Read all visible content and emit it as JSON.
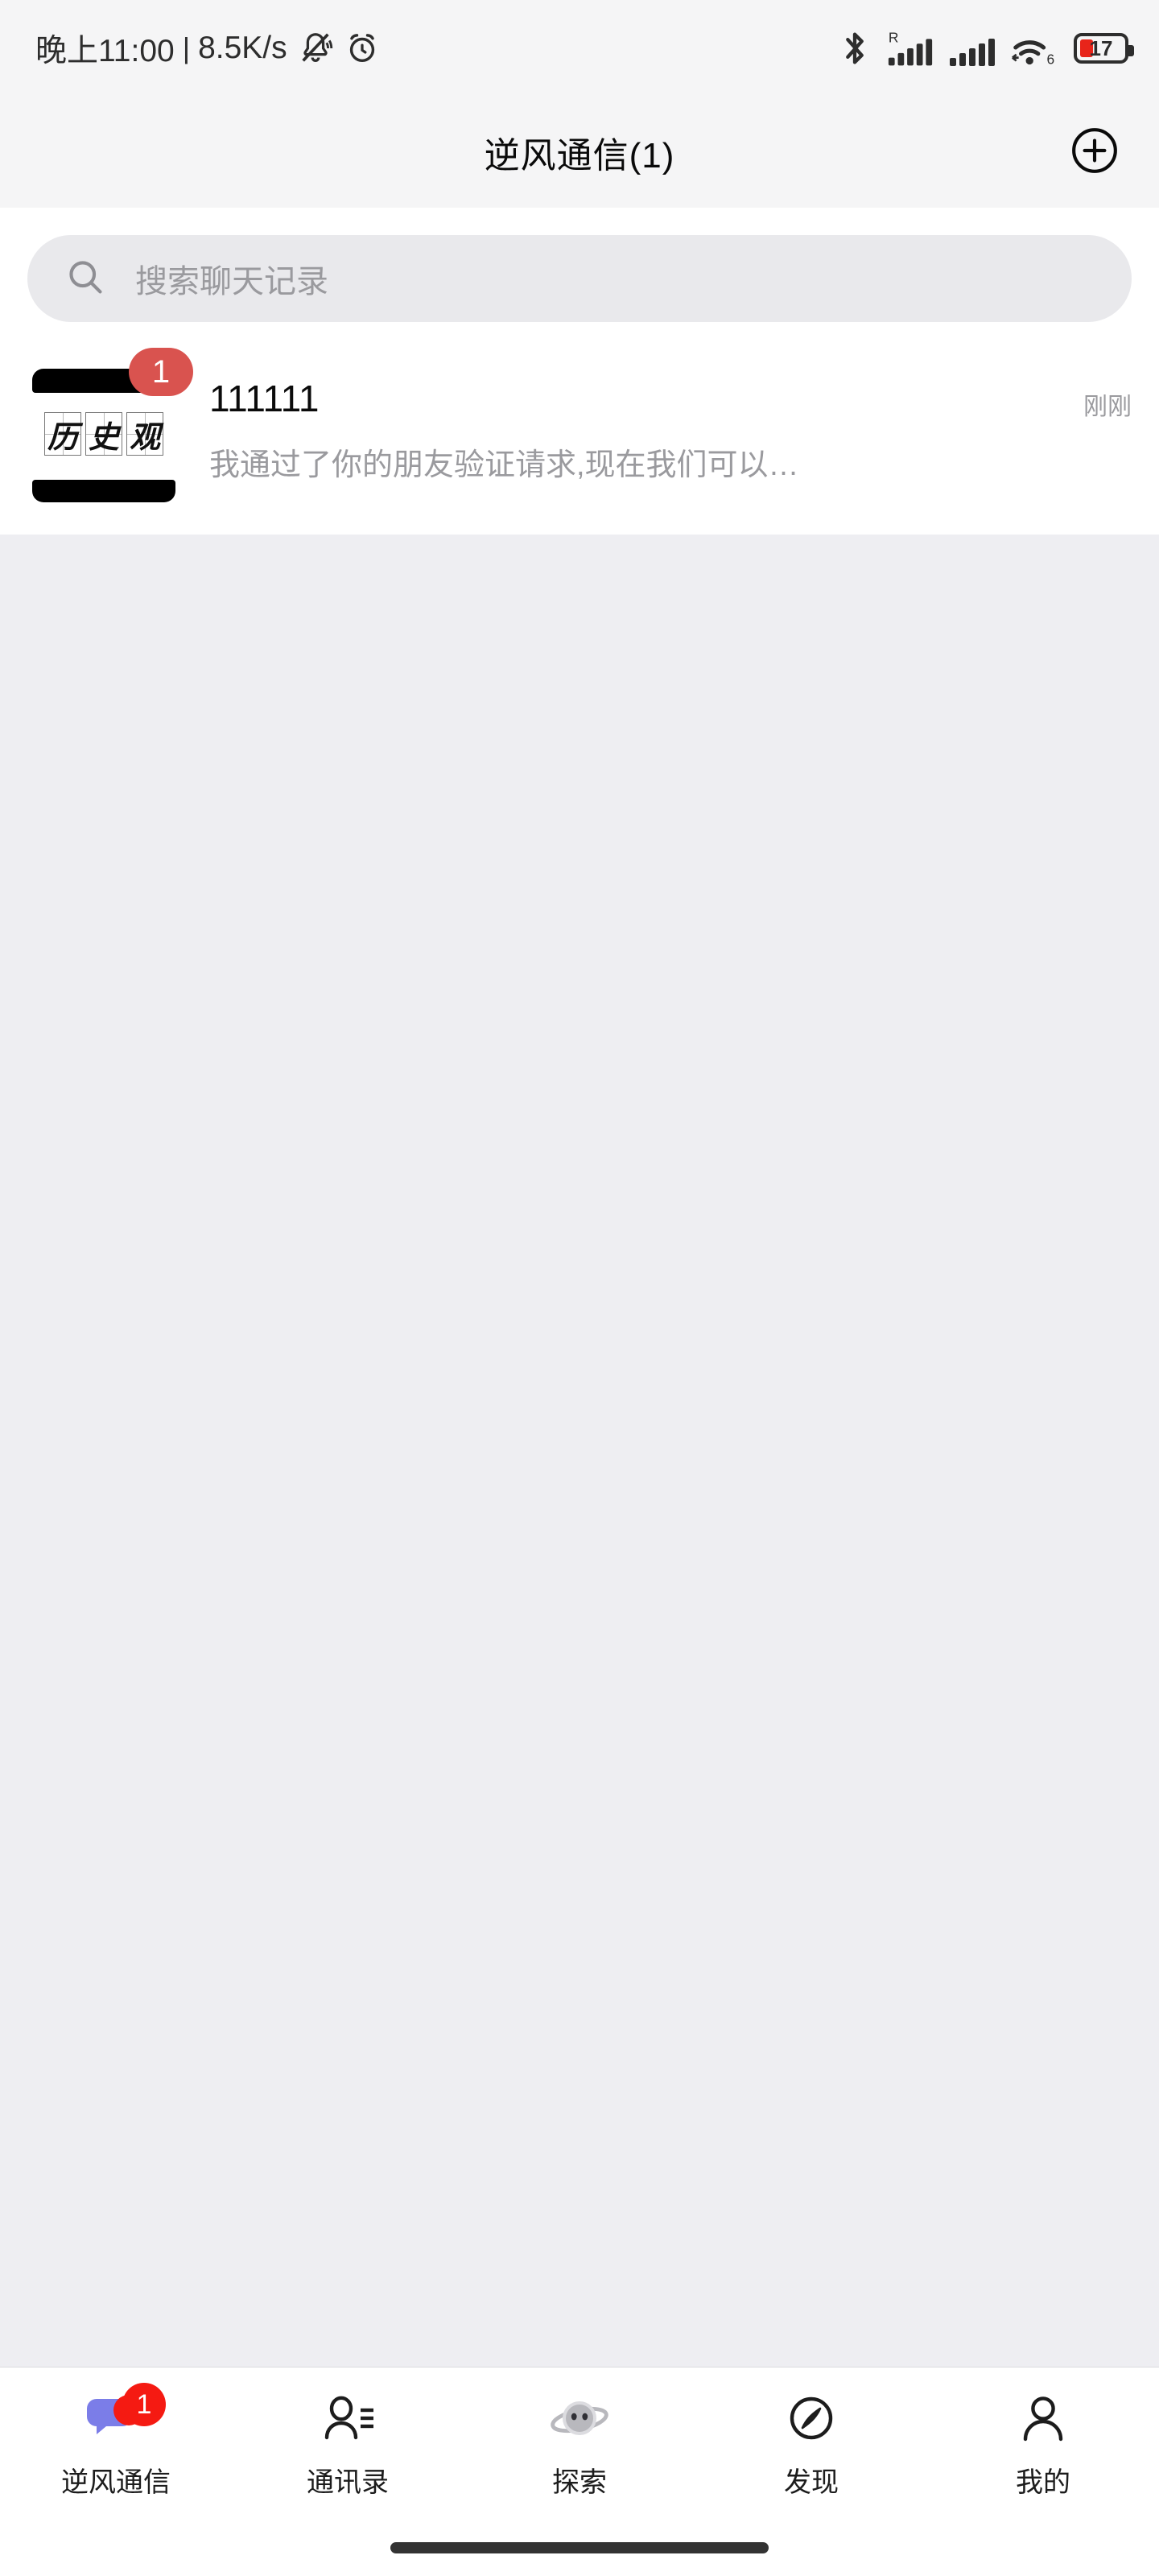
{
  "status_bar": {
    "time": "晚上11:00",
    "separator": "|",
    "network_speed": "8.5K/s",
    "icons_left": [
      "mute-bell-icon",
      "alarm-clock-icon"
    ],
    "icons_right": [
      "bluetooth-icon",
      "signal-roaming-icon",
      "signal-icon",
      "wifi6-icon"
    ],
    "battery_percent": "17",
    "battery_color": "#e8241a"
  },
  "header": {
    "title": "逆风通信(1)",
    "add_icon": "plus-circle-icon"
  },
  "search": {
    "icon": "search-icon",
    "placeholder": "搜索聊天记录",
    "value": ""
  },
  "chat_list": [
    {
      "avatar_text": [
        "历",
        "史",
        "观"
      ],
      "avatar_icon": "calligraphy-avatar",
      "unread_badge": "1",
      "name": "111111",
      "time": "刚刚",
      "preview": "我通过了你的朋友验证请求,现在我们可以…"
    }
  ],
  "tab_bar": {
    "items": [
      {
        "label": "逆风通信",
        "icon": "chat-bubbles-icon",
        "badge": "1",
        "active": true
      },
      {
        "label": "通讯录",
        "icon": "contacts-person-icon",
        "badge": "",
        "active": false
      },
      {
        "label": "探索",
        "icon": "alien-planet-icon",
        "badge": "",
        "active": false
      },
      {
        "label": "发现",
        "icon": "compass-icon",
        "badge": "",
        "active": false
      },
      {
        "label": "我的",
        "icon": "person-outline-icon",
        "badge": "",
        "active": false
      }
    ]
  },
  "colors": {
    "badge_red": "#d9534f",
    "tab_badge_red": "#f51a12",
    "accent_purple": "#7b7de8",
    "page_bg": "#eeeef2",
    "header_bg": "#f5f5f6"
  }
}
